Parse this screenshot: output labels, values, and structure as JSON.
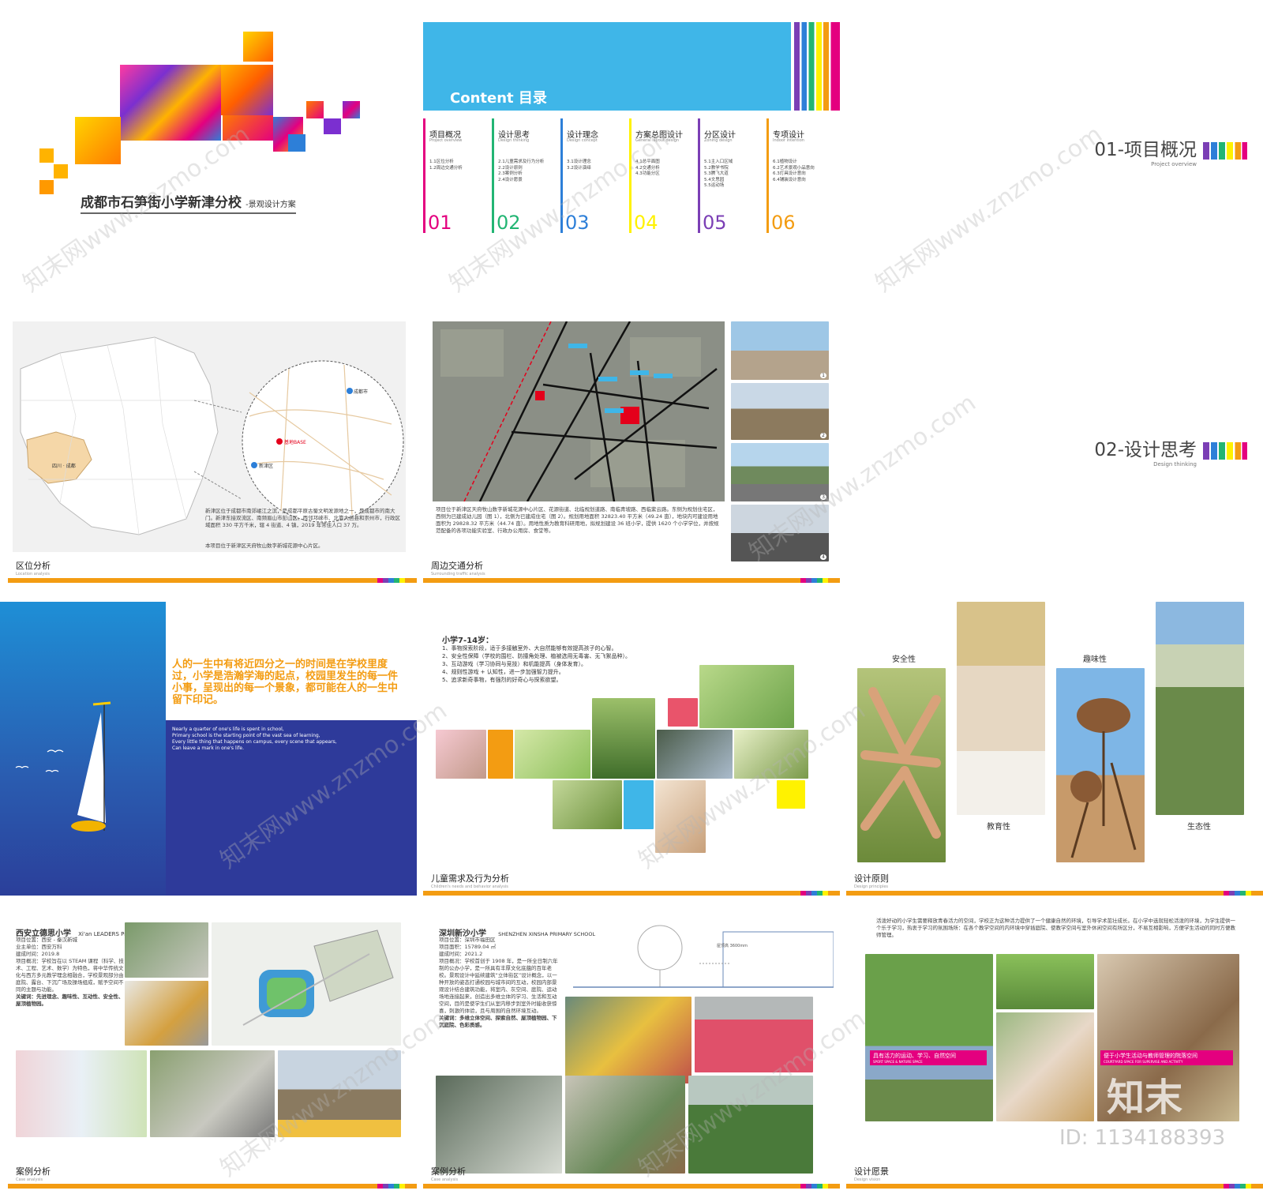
{
  "cover": {
    "title": "成都市石笋街小学新津分校",
    "subtitle": "-景观设计方案"
  },
  "contents": {
    "title": "Content  目录",
    "items": [
      {
        "num": "01",
        "title": "项目概况",
        "en": "Project overview",
        "lines": [
          "1.1区位分析",
          "1.2周边交通分析"
        ],
        "color": "#e4007f"
      },
      {
        "num": "02",
        "title": "设计思考",
        "en": "Design thinking",
        "lines": [
          "2.1儿童需求及行为分析",
          "2.2设计原则",
          "2.3案例分析",
          "2.4设计愿景"
        ],
        "color": "#22b573"
      },
      {
        "num": "03",
        "title": "设计理念",
        "en": "Design concept",
        "lines": [
          "3.1设计理念",
          "3.2设计演绎"
        ],
        "color": "#2d7fd8"
      },
      {
        "num": "04",
        "title": "方案总图设计",
        "en": "General layout design",
        "lines": [
          "4.1总平面图",
          "4.2交通分析",
          "4.3功能分区"
        ],
        "color": "#fff200"
      },
      {
        "num": "05",
        "title": "分区设计",
        "en": "Zoning design",
        "lines": [
          "5.1主入口区域",
          "5.2教学书院",
          "5.3腾飞大道",
          "5.4文思园",
          "5.5运动场"
        ],
        "color": "#7b3fb5"
      },
      {
        "num": "06",
        "title": "专项设计",
        "en": "Indoor intention",
        "lines": [
          "6.1植物设计",
          "6.2艺术景观小品意向",
          "6.3灯具设计意向",
          "6.4铺装设计意向"
        ],
        "color": "#f39c12"
      }
    ]
  },
  "section1": {
    "title": "01-项目概况",
    "en": "Project overview"
  },
  "section2": {
    "title": "02-设计思考",
    "en": "Design thinking"
  },
  "location": {
    "footer": "区位分析",
    "footer_en": "Location analysis",
    "text": "新津区位于成都市南郊岷江之滨，是成都平原古蜀文明发源地之一，是成都市的南大门。新津东接双流区、南频眉山市彭山区、西邻邛崃市、北靠大邑县和崇州市，行政区域面积 330 平方千米，辖 4 街道、4 镇，2019 年常住人口 37 万。",
    "caption": "本项目位于新津区天府牧山数字新城花源中心片区。",
    "map_labels": {
      "province": "四川 · 成都",
      "city1": "成都市",
      "site": "基地BASE",
      "city2": "新津区"
    }
  },
  "traffic": {
    "footer": "周边交通分析",
    "footer_en": "Surrounding traffic analysis",
    "text": "项目位于新津区天府牧山数字新城花源中心片区、花源街道、北临规划道路、南临青坡路、西临紫云路。东侧为规划住宅区，西侧为已建成幼儿园（图 1），北侧为已建成住宅（图 2）。规划用地面积 32823.40 平方米（49.24 亩），地块内可建设用地面积为 29828.32 平方米（44.74 亩）。用地性质为教育科研用地，拟规划建设 36 班小学，提供 1620 个小学学位，并按规范配备的各项功能实验室、行政办公用房、食堂等。",
    "photo_nums": [
      "1",
      "2",
      "3",
      "4"
    ]
  },
  "quote": {
    "cn": "人的一生中有将近四分之一的时间是在学校里度过，小学是浩瀚学海的起点，校园里发生的每一件小事，呈现出的每一个景象，都可能在人的一生中留下印记。",
    "en": [
      "Nearly a quarter of one's life is spent in school,",
      "Primary school is the starting point of the vast sea of learning,",
      "Every little thing that happens on campus, every scene that appears,",
      "Can leave a mark in one's life."
    ]
  },
  "children": {
    "footer": "儿童需求及行为分析",
    "footer_en": "Children's needs and behavior analysis",
    "title": "小学7-14岁：",
    "lines": [
      "1、事物探索阶段，适于多接触室外、大自然能够有效提高孩子的心智。",
      "2、安全性保障（学校的围栏、防撞角处理、植被选用无毒害、无飞絮品种）。",
      "3、互动游戏（学习协同与竞技）和机能提高（身体发育）。",
      "4、规则性游戏 + 认知性，进一步加强智力提升。",
      "5、追求新奇事物，有强烈的好奇心与探索欲望。"
    ]
  },
  "principles": {
    "footer": "设计原则",
    "footer_en": "Design principles",
    "labels": [
      "安全性",
      "教育性",
      "趣味性",
      "生态性"
    ]
  },
  "case1": {
    "footer": "案例分析",
    "footer_en": "Case analysis",
    "title": "西安立德思小学",
    "title_en": "Xi'an LEADERS Primary School",
    "lines": [
      "项目位置：西安 - 秦汉新城",
      "业主单位：西安万科",
      "建成时间：2019.8",
      "项目概况：学校旨在以 STEAM 课程（科学、技术、工程、艺术、数学）为特色，将中华传统文化与西方多元教学理念相融合，学校景观部分由庭院、露台、下沉广场及操场组成，赋予空间不同的主题与功能。",
      "关键词：先进理念、趣味性、互动性、安全性、屋顶植物园。"
    ]
  },
  "case2": {
    "footer": "案例分析",
    "footer_en": "Case analysis",
    "title": "深圳新沙小学",
    "title_en": "SHENZHEN XINSHA PRIMARY SCHOOL",
    "lines": [
      "项目位置：深圳市福田区",
      "项目面积：15789.04 ㎡",
      "建成时间：2021.2",
      "项目概况：学校首创于 1908 年，是一所全日制六年制的公办小学，是一所具有丰厚文化底蕴的百年老校。景观设计中延续建筑“立体街区”设计概念，以一种开放的姿态打通校园与城市间的互动，校园内部景观设计结合建筑功能，将室内、灰空间、庭院、运动场地连接起来，创造出多维立体的学习、生活和互动空间，目的是使学生们从室内移步到室外时能收获惊喜，刺激的体验，且与周围的自然环境互动。",
      "关键词：多维立体空间、探索自然、屋顶植物园、下沉庭院、色彩质感。"
    ],
    "dim_label": "屋顶高 3600mm"
  },
  "vision": {
    "footer": "设计愿景",
    "footer_en": "Design vision",
    "text": "活泼好动的小学生需要释放青春活力的空间，学校正为这种活力提供了一个健康自然的环境，引导学术茁壮成长。在小学中选就轻松活泼的环境，为学生提供一个乐于学习，热衷于学习的氛围场所：在各个教学空间的内环境中穿插庭院、使教学空间与室外休闲空间有所区分，不易互相影响，方便学生活动的同时方便教师管理。",
    "label1": "具有活力的运动、学习、自然空间",
    "label1_en": "SPORT SPACE & NATURE SPACE",
    "label2": "便于小学生活动与教师管理的院落空间",
    "label2_en": "COURTYARD SPACE FOR SUPERVISE AND ACTIVITY",
    "id": "ID: 1134188393",
    "brand": "知末"
  },
  "watermark": "知末网www.znzmo.com"
}
